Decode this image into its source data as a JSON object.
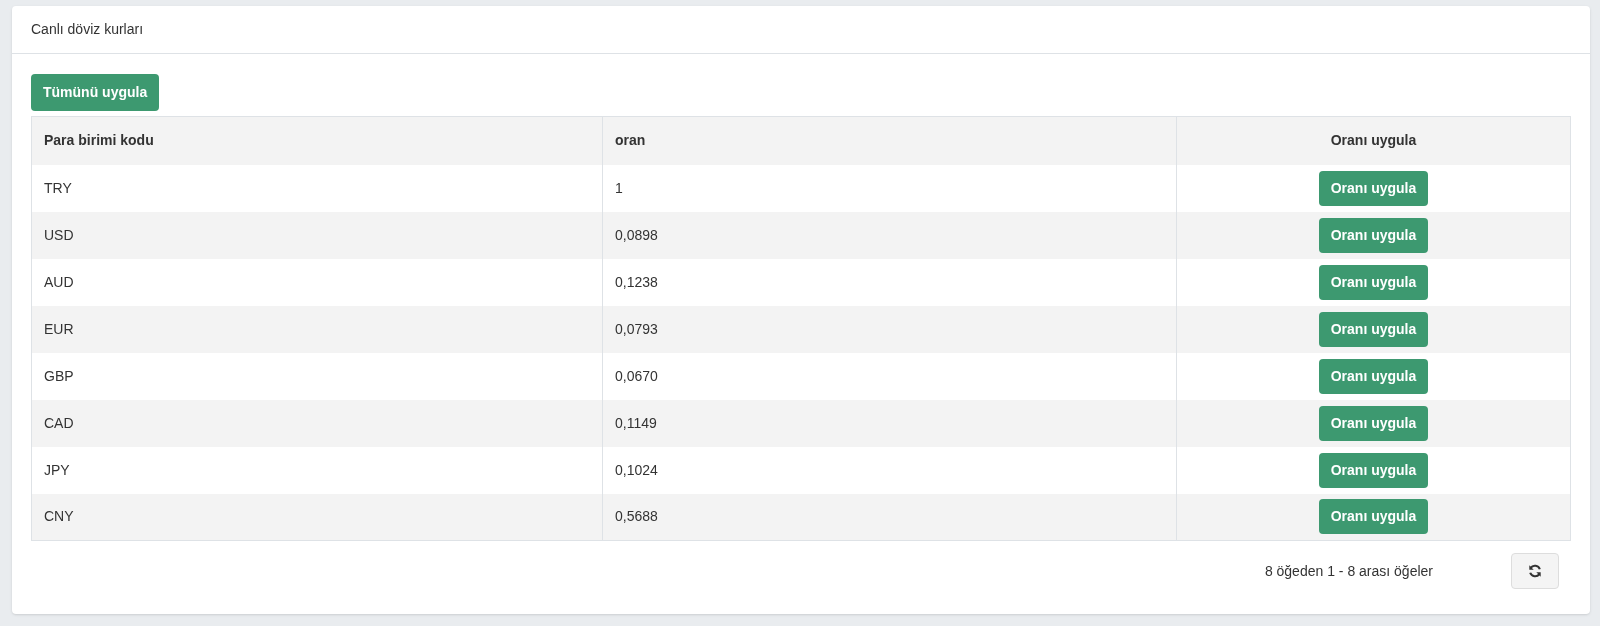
{
  "card": {
    "title": "Canlı döviz kurları"
  },
  "apply_all_button": "Tümünü uygula",
  "table": {
    "columns": [
      "Para birimi kodu",
      "oran",
      "Oranı uygula"
    ],
    "rows": [
      {
        "code": "TRY",
        "rate": "1",
        "action": "Oranı uygula"
      },
      {
        "code": "USD",
        "rate": "0,0898",
        "action": "Oranı uygula"
      },
      {
        "code": "AUD",
        "rate": "0,1238",
        "action": "Oranı uygula"
      },
      {
        "code": "EUR",
        "rate": "0,0793",
        "action": "Oranı uygula"
      },
      {
        "code": "GBP",
        "rate": "0,0670",
        "action": "Oranı uygula"
      },
      {
        "code": "CAD",
        "rate": "0,1149",
        "action": "Oranı uygula"
      },
      {
        "code": "JPY",
        "rate": "0,1024",
        "action": "Oranı uygula"
      },
      {
        "code": "CNY",
        "rate": "0,5688",
        "action": "Oranı uygula"
      }
    ]
  },
  "pager": {
    "info": "8 öğeden 1 - 8 arası öğeler"
  }
}
